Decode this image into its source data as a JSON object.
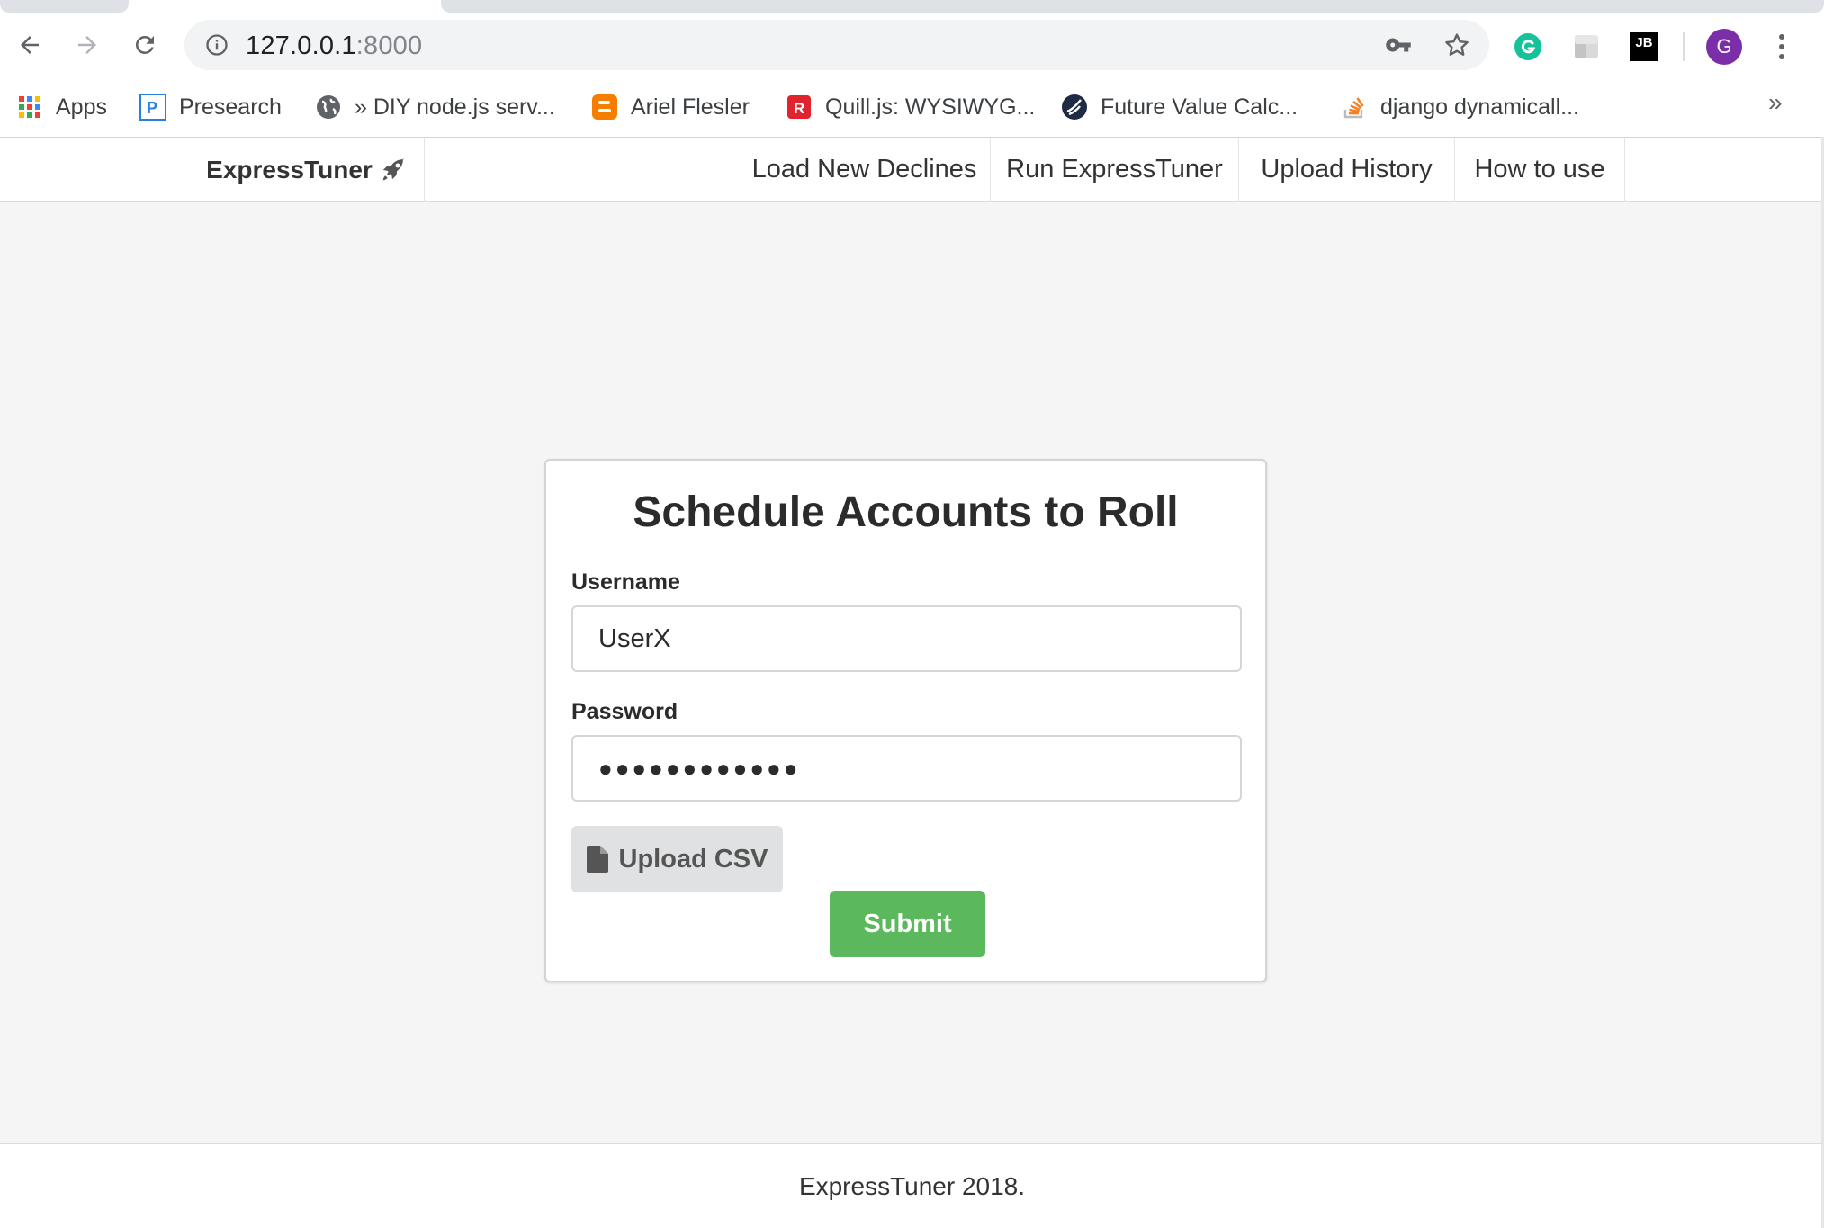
{
  "browser": {
    "url_host": "127.0.0.1",
    "url_port": ":8000",
    "avatar_initial": "G",
    "jb_label": "JB",
    "bookmarks": [
      {
        "label": "Apps",
        "icon": "apps-grid-icon"
      },
      {
        "label": "Presearch",
        "icon": "presearch-icon"
      },
      {
        "label": "» DIY node.js serv...",
        "icon": "globe-icon"
      },
      {
        "label": "Ariel Flesler",
        "icon": "blogger-icon"
      },
      {
        "label": "Quill.js: WYSIWYG...",
        "icon": "r-logo-icon"
      },
      {
        "label": "Future Value Calc...",
        "icon": "calc-logo-icon"
      },
      {
        "label": "django dynamicall...",
        "icon": "stackoverflow-icon"
      }
    ],
    "bookmarks_overflow": "»"
  },
  "navbar": {
    "brand": "ExpressTuner",
    "links": [
      "Load New Declines",
      "Run ExpressTuner",
      "Upload History",
      "How to use"
    ]
  },
  "form": {
    "title": "Schedule Accounts to Roll",
    "username_label": "Username",
    "username_value": "UserX",
    "password_label": "Password",
    "password_mask": "●●●●●●●●●●●●",
    "upload_label": "Upload CSV",
    "submit_label": "Submit"
  },
  "footer": {
    "text": "ExpressTuner 2018."
  },
  "colors": {
    "submit": "#5cb85c",
    "upload": "#e0e1e2",
    "page_bg": "#f5f5f5",
    "avatar": "#7b2ea8"
  }
}
